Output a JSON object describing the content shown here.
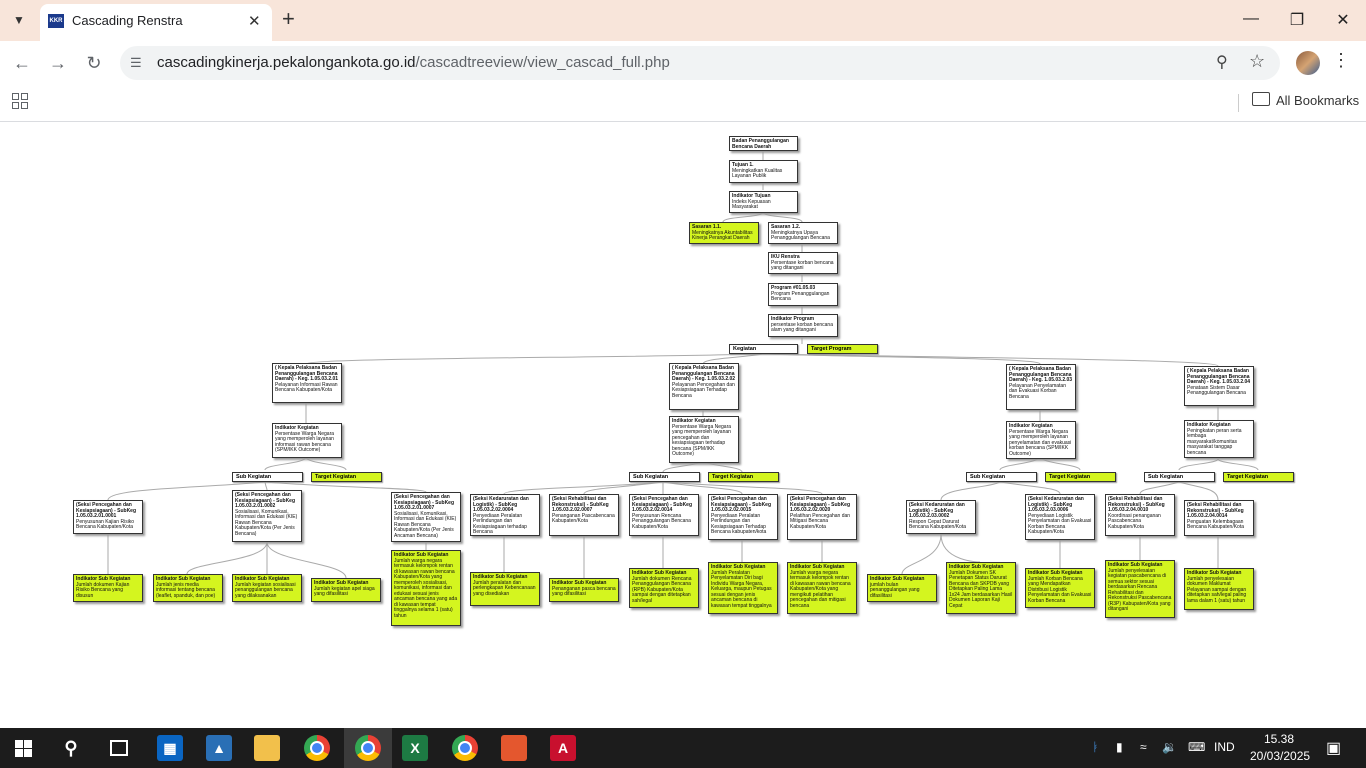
{
  "browser": {
    "tab_title": "Cascading Renstra",
    "favicon_text": "KKR",
    "url_domain": "cascadingkinerja.pekalongankota.go.id",
    "url_path": "/cascadtreeview/view_cascad_full.php",
    "bookmarks_label": "All Bookmarks"
  },
  "taskbar": {
    "lang": "IND",
    "time": "15.38",
    "date": "20/03/2025"
  },
  "tree": {
    "root": {
      "title": "Badan Penanggulangan Bencana Daerah",
      "text": ""
    },
    "tujuan": {
      "title": "Tujuan 1.",
      "text": "Meningkatkan Kualitas Layanan Publik"
    },
    "ind_tujuan": {
      "title": "Indikator Tujuan",
      "text": "Indeks Kepuasan Masyarakat"
    },
    "sasaran_1": {
      "title": "Sasaran 1.1.",
      "text": "Meningkatnya Akuntabilitas Kinerja Perangkat Daerah"
    },
    "sasaran_2": {
      "title": "Sasaran 1.2.",
      "text": "Meningkatnya Upaya Penanggulangan Bencana"
    },
    "iku": {
      "title": "IKU Renstra",
      "text": "Persentase korban bencana yang ditangani"
    },
    "program": {
      "title": "Program #01.05.03",
      "text": "Program Penanggulangan Bencana"
    },
    "ind_program": {
      "title": "Indikator Program",
      "text": "persentase korban bencana alam yang ditangani"
    },
    "lbl_kegiatan": "Kegiatan",
    "lbl_target_program": "Target Program",
    "lbl_sub_kegiatan": "Sub Kegiatan",
    "lbl_target_kegiatan": "Target Kegiatan",
    "kegiatan_1": {
      "title": "( Kepala Pelaksana Badan Penanggulangan Bencana Daerah) - Keg. 1.05.03.2.01",
      "text": "Pelayanan Informasi Rawan Bencana Kabupaten/Kota"
    },
    "kegiatan_2": {
      "title": "( Kepala Pelaksana Badan Penanggulangan Bencana Daerah) - Keg. 1.05.03.2.02",
      "text": "Pelayanan Pencegahan dan Kesiapsiagaan Terhadap Bencana"
    },
    "kegiatan_3": {
      "title": "( Kepala Pelaksana Badan Penanggulangan Bencana Daerah) - Keg. 1.05.03.2.03",
      "text": "Pelayanan Penyelamatan dan Evakuasi Korban Bencana"
    },
    "kegiatan_4": {
      "title": "( Kepala Pelaksana Badan Penanggulangan Bencana Daerah) - Keg. 1.05.03.2.04",
      "text": "Penataan Sistem Dasar Penanggulangan Bencana"
    },
    "ind_kegiatan_1": {
      "title": "Indikator Kegiatan",
      "text": "Persentase Warga Negara yang memperoleh layanan informasi rawan bencana (SPM/IKK Outcome)"
    },
    "ind_kegiatan_2": {
      "title": "Indikator Kegiatan",
      "text": "Persentase Warga Negara yang memperoleh layanan pencegahan dan kesiapsiagaan terhadap bencana (SPM/IKK Outcome)"
    },
    "ind_kegiatan_3": {
      "title": "Indikator Kegiatan",
      "text": "Persentase Warga Negara yang memperoleh layanan penyelamatan dan evakuasi korban bencana (SPM/IKK Outcome)"
    },
    "ind_kegiatan_4": {
      "title": "Indikator Kegiatan",
      "text": "Peningkatan peran serta lembaga masyarakat/komunitas masyarakat tanggap bencana"
    },
    "sub": [
      {
        "title": "(Seksi Pencegahan dan Kesiapsiagaan) - SubKeg 1.05.03.2.01.0001",
        "text": "Penyusunan Kajian Risiko Bencana Kabupaten/Kota"
      },
      {
        "title": "(Seksi Pencegahan dan Kesiapsiagaan) - SubKeg 1.05.03.2.01.0002",
        "text": "Sosialisasi, Komunikasi, Informasi dan Edukasi (KIE) Rawan Bencana Kabupaten/Kota (Per Jenis Bencana)"
      },
      {
        "title": "(Seksi Pencegahan dan Kesiapsiagaan) - SubKeg 1.05.03.2.01.0007",
        "text": "Sosialisasi, Komunikasi, Informasi dan Edukasi (KIE) Rawan Bencana Kabupaten/Kota (Per Jenis Ancaman Bencana)"
      },
      {
        "title": "(Seksi Kedaruratan dan Logistik) - SubKeg 1.05.03.2.02.0004",
        "text": "Penyediaan Peralatan Perlindungan dan Kesiapsiagaan terhadap Bencana"
      },
      {
        "title": "(Seksi Rehabilitasi dan Rekonstruksi) - SubKeg 1.05.03.2.02.0007",
        "text": "Penanganan Pascabencana Kabupaten/Kota"
      },
      {
        "title": "(Seksi Pencegahan dan Kesiapsiagaan) - SubKeg 1.05.03.2.02.0014",
        "text": "Penyusunan Rencana Penanggulangan Bencana Kabupaten/Kota"
      },
      {
        "title": "(Seksi Pencegahan dan Kesiapsiagaan) - SubKeg 1.05.03.2.02.0015",
        "text": "Penyediaan Peralatan Perlindungan dan Kesiapsiagaan Terhadap Bencana kabupaten/kota"
      },
      {
        "title": "(Seksi Pencegahan dan Kesiapsiagaan) - SubKeg 1.05.03.2.02.0020",
        "text": "Pelatihan Pencegahan dan Mitigasi Bencana Kabupaten/Kota"
      },
      {
        "title": "(Seksi Kedaruratan dan Logistik) - SubKeg 1.05.03.2.03.0002",
        "text": "Respon Cepat Darurat Bencana Kabupaten/Kota"
      },
      {
        "title": "(Seksi Kedaruratan dan Logistik) - SubKeg 1.05.03.2.03.0006",
        "text": "Penyediaan Logistik Penyelamatan dan Evakuasi Korban Bencana Kabupaten/Kota"
      },
      {
        "title": "(Seksi Rehabilitasi dan Rekonstruksi) - SubKeg 1.05.03.2.04.0010",
        "text": "Koordinasi penanganan Pascabencana Kabupaten/Kota"
      },
      {
        "title": "(Seksi Rehabilitasi dan Rekonstruksi) - SubKeg 1.05.03.2.04.0014",
        "text": "Penguatan Kelembagaan Bencana Kabupaten/Kota"
      }
    ],
    "ind_sub": [
      {
        "title": "Indikator Sub Kegiatan",
        "text": "Jumlah dokumen Kajian Risiko Bencana yang disusun"
      },
      {
        "title": "Indikator Sub Kegiatan",
        "text": "Jumlah jenis media informasi tentang bencana (leaflet, spanduk, dan poe)"
      },
      {
        "title": "Indikator Sub Kegiatan",
        "text": "Jumlah kegiatan sosialisasi penanggulangan bencana yang dilaksanakan"
      },
      {
        "title": "Indikator Sub Kegiatan",
        "text": "Jumlah kegiatan apel siaga yang difasilitasi"
      },
      {
        "title": "Indikator Sub Kegiatan",
        "text": "Jumlah warga negara termasuk kelompok rentan di kawasan rawan bencana Kabupaten/Kota yang memperoleh sosialisasi, komunikasi, informasi dan edukasi sesuai jenis ancaman bencana yang ada di kawasan tempat tinggalnya selama 1 (satu) tahun"
      },
      {
        "title": "Indikator Sub Kegiatan",
        "text": "Jumlah peralatan dan perlengkapan Kebencanaan yang disediakan"
      },
      {
        "title": "Indikator Sub Kegiatan",
        "text": "Penanganan pasca bencana yang difasilitasi"
      },
      {
        "title": "Indikator Sub Kegiatan",
        "text": "Jumlah dokumen Rencana Penanggulangan Bencana (RPB) Kabupaten/Kota sampai dengan ditetapkan sah/legal"
      },
      {
        "title": "Indikator Sub Kegiatan",
        "text": "Jumlah Peralatan Penyelamatan Diri bagi Individu Warga Negara, Keluarga, maupun Petugas sesuai dengan jenis ancaman bencana di kawasan tempat tinggalnya"
      },
      {
        "title": "Indikator Sub Kegiatan",
        "text": "Jumlah warga negara termasuk kelompok rentan di kawasan rawan bencana Kabupaten/Kota yang mengikuti pelatihan pencegahan dan mitigasi bencana"
      },
      {
        "title": "Indikator Sub Kegiatan",
        "text": "jumlah bulan penanggulangan yang difasilitasi"
      },
      {
        "title": "Indikator Sub Kegiatan",
        "text": "Jumlah Dokumen SK Penetapan Status Darurat Bencana dan SKPDB yang Ditetapkan Paling Lama 1x24 Jam berdasarkan Hasil Dokumen Laporan Kaji Cepat"
      },
      {
        "title": "Indikator Sub Kegiatan",
        "text": "Jumlah Korban Bencana yang Mendapatkan Distribusi Logistik Penyelamatan dan Evakuasi Korban Bencana"
      },
      {
        "title": "Indikator Sub Kegiatan",
        "text": "Jumlah penyelesaian kegiatan pascabencana di semua sektor sesuai berdasarkan Rencana Rehabilitasi dan Rekonstruksi Pascabencana (R3P) Kabupaten/Kota yang ditangani"
      },
      {
        "title": "Indikator Sub Kegiatan",
        "text": "Jumlah penyelesaian dokumen Maklumat Pelayanan sampai dengan ditetapkan sah/legal paling lama dalam 1 (satu) tahun"
      }
    ]
  }
}
